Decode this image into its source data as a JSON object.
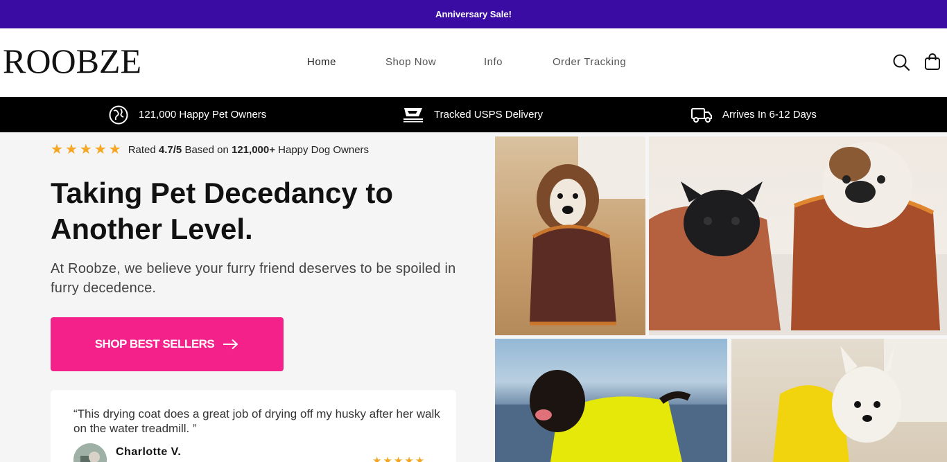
{
  "announcement": {
    "text": "Anniversary Sale!",
    "bg": "#3a0ca3"
  },
  "header": {
    "logo": "ROOBZE",
    "nav": [
      {
        "label": "Home"
      },
      {
        "label": "Shop Now"
      },
      {
        "label": "Info"
      },
      {
        "label": "Order Tracking"
      }
    ],
    "icons": [
      "search-icon",
      "cart-icon"
    ]
  },
  "benefits": [
    {
      "icon": "globe-icon",
      "label": "121,000 Happy Pet Owners"
    },
    {
      "icon": "usps-icon",
      "label": "Tracked USPS Delivery"
    },
    {
      "icon": "truck-icon",
      "label": "Arrives In 6-12 Days"
    }
  ],
  "hero": {
    "rating_prefix": "Rated",
    "rating_value": "4.7/5",
    "rating_mid": "Based on",
    "rating_count": "121,000+",
    "rating_suffix": "Happy Dog Owners",
    "headline": "Taking Pet Decedancy to Another Level.",
    "subtext": "At Roobze, we believe your furry friend deserves to be spoiled in furry decedence.",
    "cta_label": "SHOP BEST SELLERS",
    "cta_color": "#f5218a"
  },
  "review": {
    "quote": "“This drying coat does a great job of drying off my husky after her walk on the water treadmill. ”",
    "name": "Charlotte V.",
    "stars": "★★★★★"
  },
  "accent_star_color": "#f5a623"
}
